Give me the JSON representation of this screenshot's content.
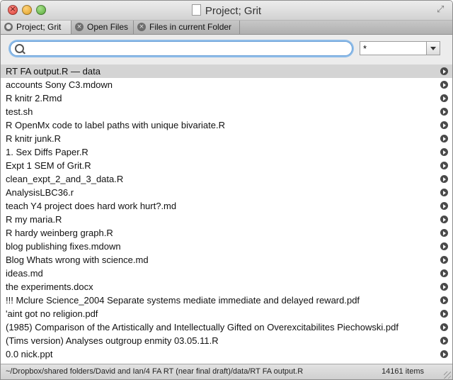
{
  "window": {
    "title": "Project; Grit"
  },
  "tabs": [
    {
      "label": "Project; Grit",
      "active": true
    },
    {
      "label": "Open Files",
      "active": false
    },
    {
      "label": "Files in current Folder",
      "active": false
    }
  ],
  "search": {
    "value": "",
    "placeholder": ""
  },
  "filter": {
    "selected": "*"
  },
  "files": [
    "RT FA output.R — data",
    "accounts Sony C3.mdown",
    "R knitr 2.Rmd",
    "test.sh",
    "R OpenMx code to label paths with unique bivariate.R",
    "R knitr junk.R",
    "1. Sex Diffs Paper.R",
    "Expt 1 SEM of Grit.R",
    "clean_expt_2_and_3_data.R",
    "AnalysisLBC36.r",
    "teach Y4 project does hard work hurt?.md",
    "R my maria.R",
    "R hardy weinberg graph.R",
    "blog publishing fixes.mdown",
    "Blog Whats wrong with science.md",
    "ideas.md",
    " the experiments.docx",
    "!!! Mclure Science_2004 Separate systems mediate immediate and delayed reward.pdf",
    "'aint got no religion.pdf",
    "(1985) Comparison of the Artistically and Intellectually Gifted on Overexcitabilites Piechowski.pdf",
    "(Tims version) Analyses outgroup enmity 03.05.11.R",
    "0.0 nick.ppt"
  ],
  "selected_index": 0,
  "status": {
    "path": "~/Dropbox/shared folders/David and Ian/4 FA RT (near final draft)/data/RT FA output.R",
    "count": "14161 items"
  },
  "colors": {
    "selection": "#d4d4d4",
    "focus_ring": "#8fbde9"
  }
}
